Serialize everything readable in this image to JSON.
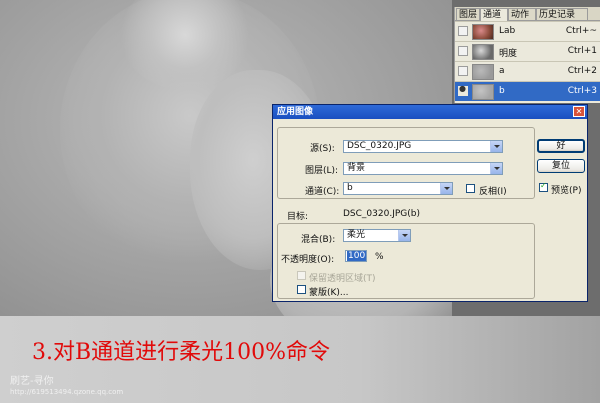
{
  "palette": {
    "tabs": [
      "图层",
      "通道",
      "动作",
      "历史记录"
    ],
    "channels": [
      {
        "name": "Lab",
        "shortcut": "Ctrl+~",
        "visible": false,
        "selected": false
      },
      {
        "name": "明度",
        "shortcut": "Ctrl+1",
        "visible": false,
        "selected": false
      },
      {
        "name": "a",
        "shortcut": "Ctrl+2",
        "visible": false,
        "selected": false
      },
      {
        "name": "b",
        "shortcut": "Ctrl+3",
        "visible": true,
        "selected": true
      }
    ]
  },
  "dialog": {
    "title": "应用图像",
    "source_label": "源(S):",
    "source_value": "DSC_0320.JPG",
    "layer_label": "图层(L):",
    "layer_value": "背景",
    "channel_label": "通道(C):",
    "channel_value": "b",
    "invert_label": "反相(I)",
    "invert_checked": false,
    "target_label": "目标:",
    "target_value": "DSC_0320.JPG(b)",
    "blending_label": "混合(B):",
    "blending_value": "柔光",
    "opacity_label": "不透明度(O):",
    "opacity_value": "100",
    "opacity_unit": "%",
    "preserve_transparency_label": "保留透明区域(T)",
    "preserve_transparency_checked": false,
    "mask_label": "蒙版(K)...",
    "mask_checked": false,
    "ok_label": "好",
    "reset_label": "复位",
    "preview_label": "预览(P)",
    "preview_checked": true
  },
  "caption": "3.对B通道进行柔光100%命令",
  "watermark": {
    "line1": "刷艺-寻你",
    "line2": "http://619513494.qzone.qq.com"
  },
  "colors": {
    "caption": "#e10a0a",
    "selection": "#316ac5",
    "titlebar": "#1f55c9"
  }
}
